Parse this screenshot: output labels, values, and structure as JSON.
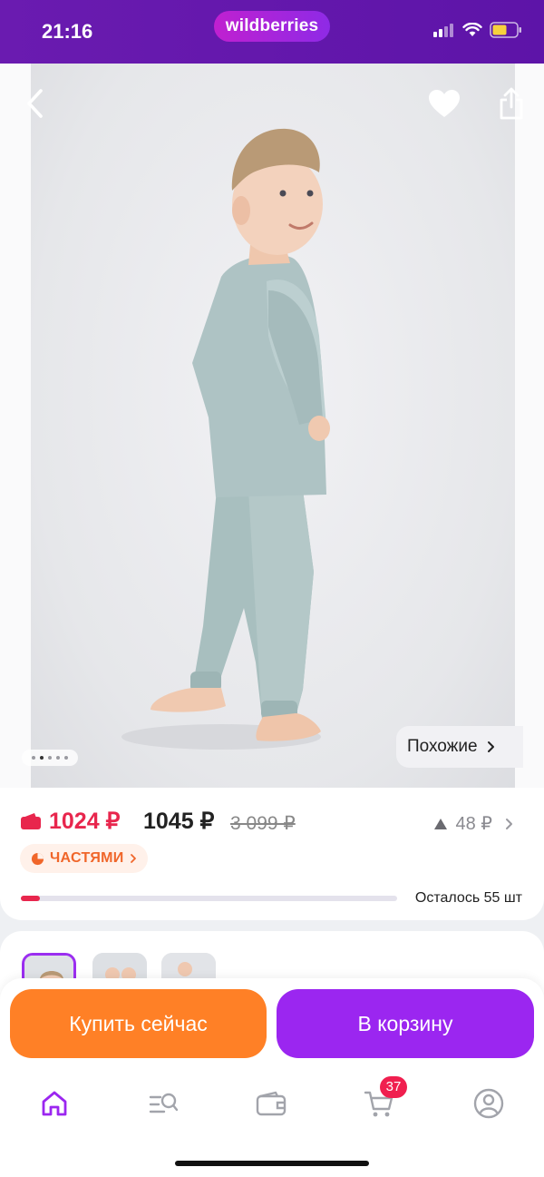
{
  "status_bar": {
    "time": "21:16",
    "brand": "wildberries"
  },
  "hero": {
    "similar_label": "Похожие",
    "image_count": 5,
    "active_image_index": 1
  },
  "price": {
    "wallet_price": "1024 ₽",
    "price": "1045 ₽",
    "old_price": "3 099 ₽",
    "delta": "48 ₽",
    "installments_label": "ЧАСТЯМИ",
    "stock_text": "Осталось 55 шт",
    "stock_progress": 0.05
  },
  "actions": {
    "buy_now": "Купить сейчас",
    "add_to_cart": "В корзину"
  },
  "tabbar": {
    "items": [
      {
        "icon": "home-icon",
        "active": true
      },
      {
        "icon": "search-catalog-icon",
        "active": false
      },
      {
        "icon": "wallet-icon",
        "active": false
      },
      {
        "icon": "cart-icon",
        "active": false
      },
      {
        "icon": "profile-icon",
        "active": false
      }
    ],
    "cart_badge": "37"
  },
  "colors": {
    "brand": "#6a1bb0",
    "accent_purple": "#9b26f0",
    "accent_orange": "#ff8026",
    "price_red": "#e8264d"
  }
}
